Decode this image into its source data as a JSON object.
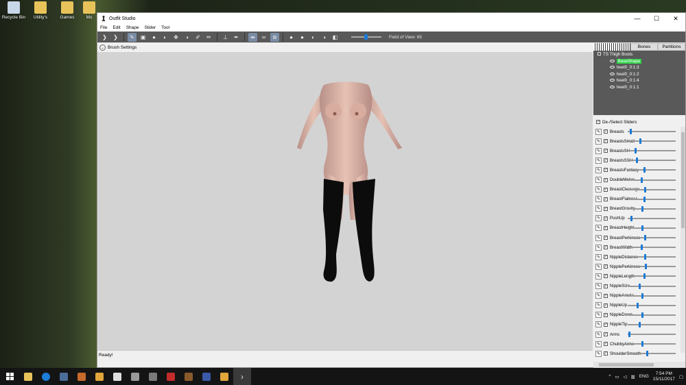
{
  "desktop": {
    "icons": [
      {
        "label": "Recycle Bin"
      },
      {
        "label": "Utility's"
      },
      {
        "label": "Games"
      },
      {
        "label": "Mo"
      }
    ]
  },
  "window": {
    "title": "Outfit Studio",
    "controls": {
      "minimize": "—",
      "maximize": "☐",
      "close": "✕"
    }
  },
  "menu": [
    "File",
    "Edit",
    "Shape",
    "Slider",
    "Tool"
  ],
  "toolbar": {
    "field_of_view_label": "Field of View: 65",
    "fov_value": 65
  },
  "brush_settings": {
    "label": "Brush Settings"
  },
  "status": {
    "text": "Ready!"
  },
  "right_panel": {
    "tabs": [
      "Bones",
      "Partitions"
    ],
    "tree": {
      "root": "TS Thigh Boots",
      "children": [
        "BaseShape",
        "heel0_0:1:3",
        "heel0_0:1:2",
        "heel0_0:1:4",
        "heel0_0:1:1"
      ]
    },
    "slider_header": "De-/Select Sliders",
    "sliders": [
      {
        "name": "Breasts",
        "value": 0.05
      },
      {
        "name": "BreastsSmall",
        "value": 0.25
      },
      {
        "name": "BreastsSH",
        "value": 0.15
      },
      {
        "name": "BreastsSSH",
        "value": 0.18
      },
      {
        "name": "BreastsFantasy",
        "value": 0.35
      },
      {
        "name": "DoubleMelon",
        "value": 0.28
      },
      {
        "name": "BreastCleavage",
        "value": 0.36
      },
      {
        "name": "BreastFlatness",
        "value": 0.34
      },
      {
        "name": "BreastGravity",
        "value": 0.3
      },
      {
        "name": "PushUp",
        "value": 0.06
      },
      {
        "name": "BreastHeight",
        "value": 0.3
      },
      {
        "name": "BreastPerkiness",
        "value": 0.36
      },
      {
        "name": "BreastWidth",
        "value": 0.28
      },
      {
        "name": "NippleDistance",
        "value": 0.36
      },
      {
        "name": "NipplePerkiness",
        "value": 0.38
      },
      {
        "name": "NippleLength",
        "value": 0.34
      },
      {
        "name": "NippleSize",
        "value": 0.24
      },
      {
        "name": "NippleAreola",
        "value": 0.3
      },
      {
        "name": "NippleUp",
        "value": 0.2
      },
      {
        "name": "NippleDown",
        "value": 0.3
      },
      {
        "name": "NippleTip",
        "value": 0.24
      },
      {
        "name": "Arms",
        "value": 0.02
      },
      {
        "name": "ChubbyArms",
        "value": 0.3
      },
      {
        "name": "ShoulderSmooth",
        "value": 0.4
      }
    ]
  },
  "taskbar": {
    "language": "ENG",
    "time": "7:54 PM",
    "date": "15/11/2017"
  },
  "colors": {
    "toolbar_bg": "#595959",
    "viewport_bg": "#d3d3d3",
    "selected_shape": "#32d24a",
    "slider_knob": "#1e7ad6"
  }
}
